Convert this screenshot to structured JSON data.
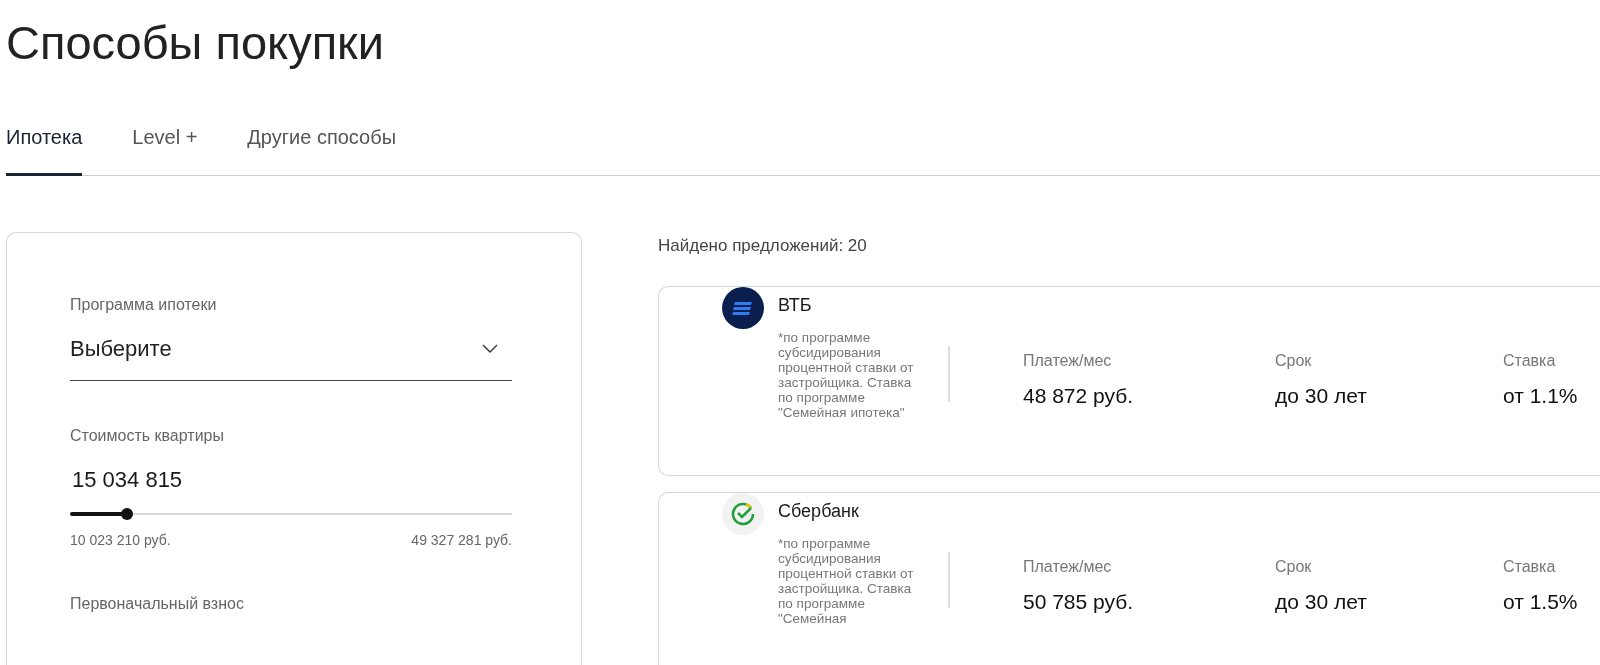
{
  "title": "Способы покупки",
  "tabs": [
    {
      "label": "Ипотека",
      "selected": true
    },
    {
      "label": "Level +",
      "selected": false
    },
    {
      "label": "Другие способы",
      "selected": false
    }
  ],
  "filters": {
    "program": {
      "label": "Программа ипотеки",
      "value": "Выберите"
    },
    "price": {
      "label": "Стоимость квартиры",
      "value": "15 034 815",
      "level": 0.13,
      "min": "10 023 210 руб.",
      "max": "49 327 281 руб."
    },
    "down_payment": {
      "label": "Первоначальный взнос"
    }
  },
  "results": {
    "count": "Найдено предложений: 20",
    "offers": [
      {
        "bank": "ВТБ",
        "kind": "vtb",
        "note": "*по программе субсидирования процентной ставки от застройщика. Ставка по программе \"Семейная ипотека\"",
        "payment_label": "Платеж/мес",
        "payment": "48 872 руб.",
        "term_label": "Срок",
        "term": "до 30 лет",
        "rate_label": "Ставка",
        "rate": "от 1.1%"
      },
      {
        "bank": "Сбербанк",
        "kind": "sber",
        "note": "*по программе субсидирования процентной ставки от застройщика. Ставка по программе \"Семейная",
        "payment_label": "Платеж/мес",
        "payment": "50 785 руб.",
        "term_label": "Срок",
        "term": "до 30 лет",
        "rate_label": "Ставка",
        "rate": "от 1.5%"
      }
    ]
  }
}
